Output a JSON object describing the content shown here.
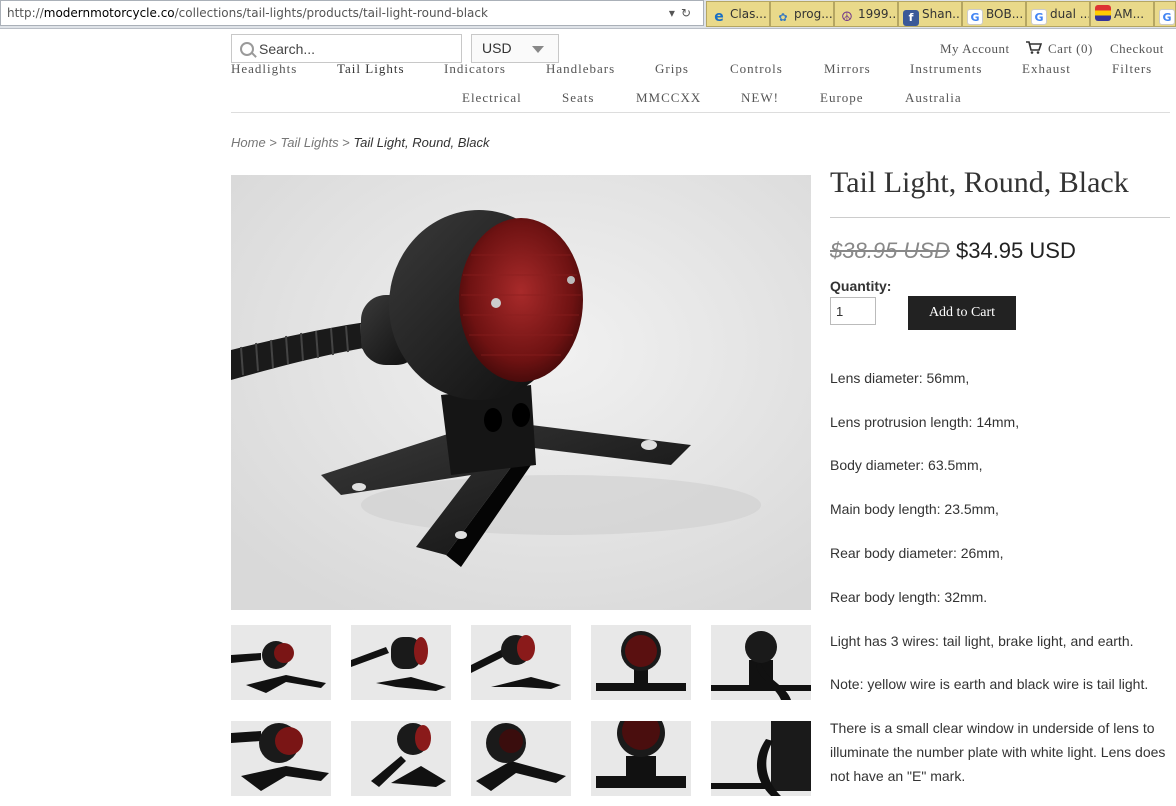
{
  "browser": {
    "url_prefix": "http://",
    "url_domain": "modernmotorcycle.co",
    "url_path": "/collections/tail-lights/products/tail-light-round-black",
    "tabs": [
      {
        "label": "Clas...",
        "icon": "ie-icon"
      },
      {
        "label": "prog...",
        "icon": "bird-icon"
      },
      {
        "label": "1999...",
        "icon": "peace-icon"
      },
      {
        "label": "Shan...",
        "icon": "facebook-icon"
      },
      {
        "label": "BOB...",
        "icon": "google-icon"
      },
      {
        "label": "dual ...",
        "icon": "google-icon"
      },
      {
        "label": "AM...",
        "icon": "flag-icon"
      }
    ]
  },
  "header": {
    "search_placeholder": "Search...",
    "currency": "USD",
    "my_account": "My Account",
    "cart": "Cart (0)",
    "checkout": "Checkout"
  },
  "nav": {
    "row1": [
      "Headlights",
      "Tail Lights",
      "Indicators",
      "Handlebars",
      "Grips",
      "Controls",
      "Mirrors",
      "Instruments",
      "Exhaust",
      "Filters"
    ],
    "row2": [
      "Electrical",
      "Seats",
      "MMCCXX",
      "NEW!",
      "Europe",
      "Australia"
    ]
  },
  "breadcrumb": {
    "home": "Home",
    "sep": ">",
    "category": "Tail Lights",
    "current": "Tail Light, Round, Black"
  },
  "product": {
    "title": "Tail Light, Round, Black",
    "old_price": "$38.95 USD",
    "price": "$34.95 USD",
    "quantity_label": "Quantity:",
    "quantity": "1",
    "add_to_cart": "Add to Cart",
    "specs": [
      "Lens diameter: 56mm,",
      "Lens protrusion length: 14mm,",
      "Body diameter: 63.5mm,",
      "Main body length: 23.5mm,",
      "Rear body diameter: 26mm,",
      "Rear body length: 32mm.",
      "Light has 3 wires: tail light, brake light, and earth.",
      "Note: yellow wire is earth and black wire is tail light.",
      "There is a small clear window in underside of lens to illuminate the number plate with white light. Lens does not have an \"E\" mark."
    ]
  }
}
